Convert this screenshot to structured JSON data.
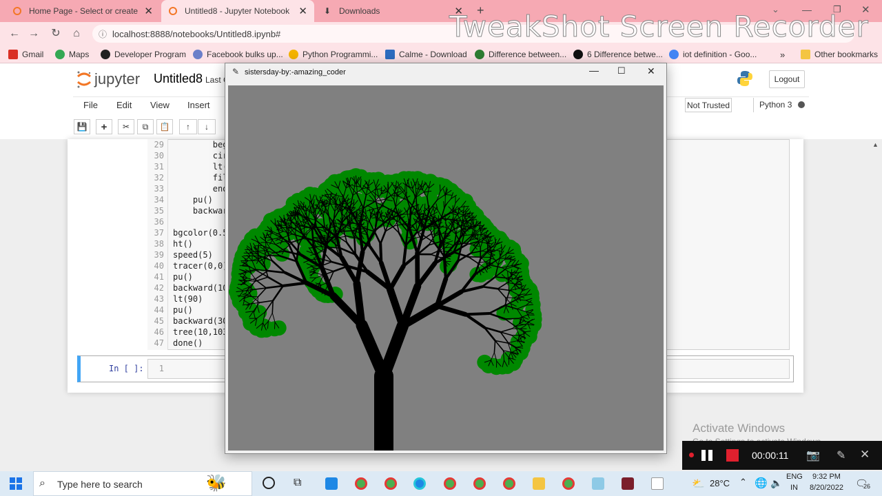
{
  "browser": {
    "tabs": [
      {
        "label": "Home Page - Select or create a n",
        "icon": "jupyter-icon"
      },
      {
        "label": "Untitled8 - Jupyter Notebook",
        "icon": "jupyter-icon"
      },
      {
        "label": "Downloads",
        "icon": "download-icon"
      }
    ],
    "new_tab": "+",
    "url": "localhost:8888/notebooks/Untitled8.ipynb#",
    "bookmarks": [
      {
        "label": "Gmail",
        "color": "#d93025"
      },
      {
        "label": "Maps",
        "color": "#34a853"
      },
      {
        "label": "Developer Program",
        "color": "#222222"
      },
      {
        "label": "Facebook bulks up...",
        "color": "#6b7fc9"
      },
      {
        "label": "Python Programmi...",
        "color": "#f5b400"
      },
      {
        "label": "Calme - Download",
        "color": "#2d6cc0"
      },
      {
        "label": "Difference between...",
        "color": "#2e7d32"
      },
      {
        "label": "6 Difference betwe...",
        "color": "#111111"
      },
      {
        "label": "iot definition - Goo...",
        "color": "#4285f4"
      }
    ],
    "more": "»",
    "other_bookmarks": "Other bookmarks"
  },
  "watermark": "TweakShot Screen Recorder",
  "jupyter": {
    "logo": "jupyter",
    "notebook_name": "Untitled8",
    "last_checkpoint": "Last C",
    "logout": "Logout",
    "menus": [
      "File",
      "Edit",
      "View",
      "Insert"
    ],
    "not_trusted": "Not Trusted",
    "kernel": "Python 3",
    "code_lines": [
      {
        "n": "29",
        "t": "        beg"
      },
      {
        "n": "30",
        "t": "        cir"
      },
      {
        "n": "31",
        "t": "        lt("
      },
      {
        "n": "32",
        "t": "        fil"
      },
      {
        "n": "33",
        "t": "        end"
      },
      {
        "n": "34",
        "t": "    pu()"
      },
      {
        "n": "35",
        "t": "    backwar"
      },
      {
        "n": "36",
        "t": ""
      },
      {
        "n": "37",
        "t": "bgcolor(0.5"
      },
      {
        "n": "38",
        "t": "ht()"
      },
      {
        "n": "39",
        "t": "speed(5)"
      },
      {
        "n": "40",
        "t": "tracer(0,0)"
      },
      {
        "n": "41",
        "t": "pu()"
      },
      {
        "n": "42",
        "t": "backward(10"
      },
      {
        "n": "43",
        "t": "lt(90)"
      },
      {
        "n": "44",
        "t": "pu()"
      },
      {
        "n": "45",
        "t": "backward(30"
      },
      {
        "n": "46",
        "t": "tree(10,103"
      },
      {
        "n": "47",
        "t": "done()"
      }
    ],
    "prompt": "In [ ]:",
    "empty_line": "1"
  },
  "turtle_window": {
    "title": "sistersday-by:-amazing_coder",
    "bg_color": "#808080",
    "trunk_color": "#000000",
    "leaf_color": "#008800"
  },
  "activate_windows": {
    "title": "Activate Windows",
    "subtitle": "Go to Settings to activate Windows."
  },
  "recorder": {
    "time": "00:00:11"
  },
  "taskbar": {
    "search_placeholder": "Type here to search",
    "temperature": "28°C",
    "lang1": "ENG",
    "lang2": "IN",
    "time": "9:32 PM",
    "date": "8/20/2022",
    "notifications": "26"
  }
}
